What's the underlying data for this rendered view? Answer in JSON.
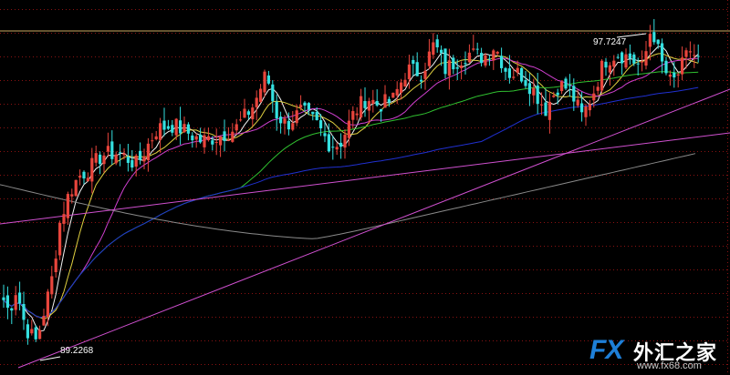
{
  "chart_data": {
    "type": "candlestick",
    "annotations": [
      {
        "label": "97.7247",
        "kind": "high-marker"
      },
      {
        "label": "89.2268",
        "kind": "low-marker"
      }
    ],
    "ylim": [
      88.9,
      98.0
    ],
    "high": 97.7247,
    "low": 89.2268,
    "colors": {
      "background": "#000000",
      "grid": "#8a1212",
      "up_candle": "#e8453c",
      "down_candle": "#34e0e0",
      "ma5": "#f2f2f2",
      "ma10": "#e0d040",
      "ma20": "#d040d0",
      "ma60": "#30c030",
      "ma120": "#2030d0",
      "ma250": "#8a8a8a",
      "trendline": "#d050d0",
      "resistance": "#c8a860"
    },
    "grid": true
  },
  "watermark": {
    "brand": "FX",
    "chinese": "外汇之家",
    "url": "www.fx68.com"
  }
}
